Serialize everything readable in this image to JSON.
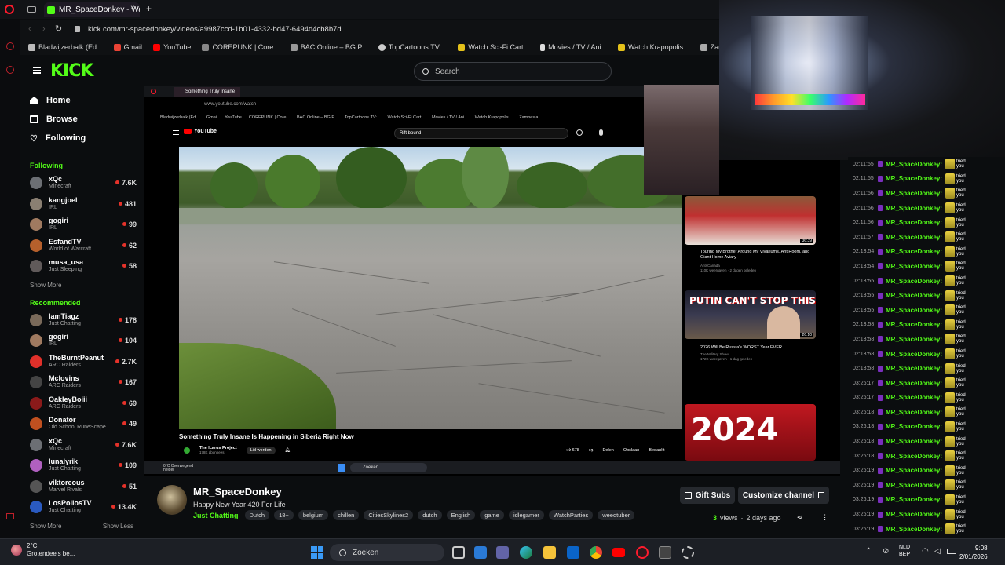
{
  "browser": {
    "tab_title": "MR_SpaceDonkey - Wa",
    "url": "kick.com/mr-spacedonkey/videos/a9987ccd-1b01-4332-bd47-6494d4cb8b7d",
    "bookmarks": [
      "Bladwijzerbalk (Ed...",
      "Gmail",
      "YouTube",
      "COREPUNK | Core...",
      "BAC Online – BG P...",
      "TopCartoons.TV:...",
      "Watch Sci-Fi Cart...",
      "Movies / TV / Ani...",
      "Watch Krapopolis...",
      "Zamnesia"
    ]
  },
  "kick": {
    "logo": "KICK",
    "search_placeholder": "Search",
    "nav": [
      {
        "label": "Home",
        "icon": "home-icon"
      },
      {
        "label": "Browse",
        "icon": "browse-icon"
      },
      {
        "label": "Following",
        "icon": "heart-icon"
      }
    ],
    "following_title": "Following",
    "following": [
      {
        "name": "xQc",
        "cat": "Minecraft",
        "viewers": "7.6K",
        "color": "#6c6f74"
      },
      {
        "name": "kangjoel",
        "cat": "IRL",
        "viewers": "481",
        "color": "#8a7f72"
      },
      {
        "name": "gogiri",
        "cat": "IRL",
        "viewers": "99",
        "color": "#a07a60"
      },
      {
        "name": "EsfandTV",
        "cat": "World of Warcraft",
        "viewers": "62",
        "color": "#b6602c"
      },
      {
        "name": "musa_usa",
        "cat": "Just Sleeping",
        "viewers": "58",
        "color": "#605a5a"
      }
    ],
    "show_more": "Show More",
    "recommended_title": "Recommended",
    "recommended": [
      {
        "name": "IamTiagz",
        "cat": "Just Chatting",
        "viewers": "178",
        "color": "#7a6a5a"
      },
      {
        "name": "gogiri",
        "cat": "IRL",
        "viewers": "104",
        "color": "#a07a60"
      },
      {
        "name": "TheBurntPeanut",
        "cat": "ARC Raiders",
        "viewers": "2.7K",
        "color": "#e0302a"
      },
      {
        "name": "Mclovins",
        "cat": "ARC Raiders",
        "viewers": "167",
        "color": "#444"
      },
      {
        "name": "OakleyBoiii",
        "cat": "ARC Raiders",
        "viewers": "69",
        "color": "#8a1a1a"
      },
      {
        "name": "Donator",
        "cat": "Old School RuneScape",
        "viewers": "49",
        "color": "#c05020"
      },
      {
        "name": "xQc",
        "cat": "Minecraft",
        "viewers": "7.6K",
        "color": "#6c6f74"
      },
      {
        "name": "lunalyrik",
        "cat": "Just Chatting",
        "viewers": "109",
        "color": "#b060c0"
      },
      {
        "name": "viktoreous",
        "cat": "Marvel Rivals",
        "viewers": "51",
        "color": "#555"
      },
      {
        "name": "LosPollosTV",
        "cat": "Just Chatting",
        "viewers": "13.4K",
        "color": "#2a5ac0"
      }
    ],
    "show_more2": "Show More",
    "show_less": "Show Less"
  },
  "inner": {
    "tab": "Something Truly Insane",
    "url": "www.youtube.com/watch",
    "bookmarks": [
      "Bladwijzerbalk (Ed...",
      "Gmail",
      "YouTube",
      "COREPUNK | Core...",
      "BAC Online – BG P...",
      "TopCartoons.TV:...",
      "Watch Sci-Fi Cart...",
      "Movies / TV / Ani...",
      "Watch Krapopolis...",
      "Zamnesia"
    ],
    "yt_logo": "YouTube",
    "yt_search": "Rift bound",
    "video_title": "Something Truly Insane Is Happening in Siberia Right Now",
    "channel": "The Icarus Project",
    "subs": "178K abonnees",
    "subscribe": "Lid worden",
    "likes": "678",
    "share": "Delen",
    "save": "Opslaan",
    "thanks": "Bedankt",
    "rec": [
      {
        "title": "Touring My Brother Around My Vivariums, Ant Room, and Giant Home Aviary",
        "channel": "AntsCanada",
        "meta": "110K weergaven · 2 dagen geleden",
        "duration": "36:39"
      },
      {
        "title": "2026 Will Be Russia's WORST Year EVER",
        "channel": "The Military Show",
        "meta": "172K weergaven · 1 dag geleden",
        "duration": "26:10",
        "thumb_text": "PUTIN CAN'T STOP THIS"
      },
      {
        "title": "",
        "thumb_text": "2024"
      }
    ],
    "taskbar_search": "Zoeken",
    "weather": "0°C Overwegend helder"
  },
  "chat": {
    "messages": [
      {
        "time": "02:11:55",
        "user": "MR_SpaceDonkey:",
        "msg": "tried you"
      },
      {
        "time": "02:11:55",
        "user": "MR_SpaceDonkey:",
        "msg": "tried you"
      },
      {
        "time": "02:11:56",
        "user": "MR_SpaceDonkey:",
        "msg": "tried you"
      },
      {
        "time": "02:11:56",
        "user": "MR_SpaceDonkey:",
        "msg": "tried you"
      },
      {
        "time": "02:11:56",
        "user": "MR_SpaceDonkey:",
        "msg": "tried you"
      },
      {
        "time": "02:11:57",
        "user": "MR_SpaceDonkey:",
        "msg": "tried you"
      },
      {
        "time": "02:13:54",
        "user": "MR_SpaceDonkey:",
        "msg": "tried you"
      },
      {
        "time": "02:13:54",
        "user": "MR_SpaceDonkey:",
        "msg": "tried you"
      },
      {
        "time": "02:13:55",
        "user": "MR_SpaceDonkey:",
        "msg": "tried you"
      },
      {
        "time": "02:13:55",
        "user": "MR_SpaceDonkey:",
        "msg": "tried you"
      },
      {
        "time": "02:13:55",
        "user": "MR_SpaceDonkey:",
        "msg": "tried you"
      },
      {
        "time": "02:13:58",
        "user": "MR_SpaceDonkey:",
        "msg": "tried you"
      },
      {
        "time": "02:13:58",
        "user": "MR_SpaceDonkey:",
        "msg": "tried you"
      },
      {
        "time": "02:13:58",
        "user": "MR_SpaceDonkey:",
        "msg": "tried you"
      },
      {
        "time": "02:13:58",
        "user": "MR_SpaceDonkey:",
        "msg": "tried you"
      },
      {
        "time": "03:26:17",
        "user": "MR_SpaceDonkey:",
        "msg": "tried you"
      },
      {
        "time": "03:26:17",
        "user": "MR_SpaceDonkey:",
        "msg": "tried you"
      },
      {
        "time": "03:26:18",
        "user": "MR_SpaceDonkey:",
        "msg": "tried you"
      },
      {
        "time": "03:26:18",
        "user": "MR_SpaceDonkey:",
        "msg": "tried you"
      },
      {
        "time": "03:26:18",
        "user": "MR_SpaceDonkey:",
        "msg": "tried you"
      },
      {
        "time": "03:26:18",
        "user": "MR_SpaceDonkey:",
        "msg": "tried you"
      },
      {
        "time": "03:26:19",
        "user": "MR_SpaceDonkey:",
        "msg": "tried you"
      },
      {
        "time": "03:26:19",
        "user": "MR_SpaceDonkey:",
        "msg": "tried you"
      },
      {
        "time": "03:26:19",
        "user": "MR_SpaceDonkey:",
        "msg": "tried you"
      },
      {
        "time": "03:26:19",
        "user": "MR_SpaceDonkey:",
        "msg": "tried you"
      },
      {
        "time": "03:26:19",
        "user": "MR_SpaceDonkey:",
        "msg": "tried you"
      }
    ]
  },
  "stream": {
    "name": "MR_SpaceDonkey",
    "title": "Happy New Year 420 For Life",
    "category": "Just Chatting",
    "tags": [
      "Dutch",
      "18+",
      "belgium",
      "chillen",
      "CitiesSkylines2",
      "dutch",
      "English",
      "game",
      "idlegamer",
      "WatchParties",
      "weedtuber"
    ],
    "gift_subs": "Gift Subs",
    "customize": "Customize channel",
    "views_count": "3",
    "views_label": "views",
    "age": "2 days ago"
  },
  "taskbar": {
    "weather_temp": "2°C",
    "weather_desc": "Grotendeels be...",
    "search": "Zoeken",
    "lang1": "NLD",
    "lang2": "BEP",
    "time": "9:08",
    "date": "2/01/2026"
  },
  "colors": {
    "kick_green": "#53fc18",
    "live_red": "#e5322a",
    "opera_red": "#ff1b2d"
  }
}
